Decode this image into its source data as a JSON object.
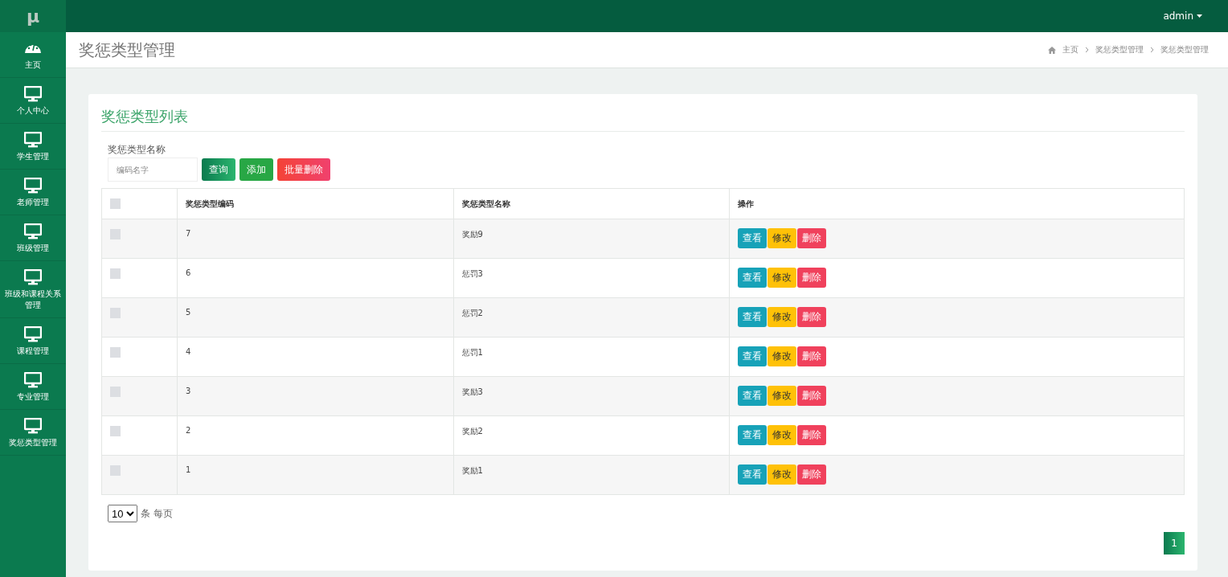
{
  "sidebar": {
    "logo": "μ",
    "items": [
      {
        "label": "主页",
        "kind": "gauge"
      },
      {
        "label": "个人中心",
        "kind": "monitor"
      },
      {
        "label": "学生管理",
        "kind": "monitor"
      },
      {
        "label": "老师管理",
        "kind": "monitor"
      },
      {
        "label": "班级管理",
        "kind": "monitor"
      },
      {
        "label": "班级和课程关系管理",
        "kind": "monitor"
      },
      {
        "label": "课程管理",
        "kind": "monitor"
      },
      {
        "label": "专业管理",
        "kind": "monitor"
      },
      {
        "label": "奖惩类型管理",
        "kind": "monitor"
      }
    ]
  },
  "topbar": {
    "user": "admin"
  },
  "header": {
    "title": "奖惩类型管理",
    "breadcrumb": [
      "主页",
      "奖惩类型管理",
      "奖惩类型管理"
    ]
  },
  "card": {
    "title": "奖惩类型列表",
    "search": {
      "label": "奖惩类型名称",
      "placeholder": "编码名字"
    },
    "buttons": [
      {
        "label": "查询",
        "kind": "query"
      },
      {
        "label": "添加",
        "kind": "add"
      },
      {
        "label": "批量删除",
        "kind": "delete"
      }
    ],
    "table": {
      "header_checked": false,
      "columns": [
        "奖惩类型编码",
        "奖惩类型名称",
        "操作"
      ],
      "rows": [
        {
          "checked": false,
          "code": "7",
          "name": "奖励9",
          "actions": [
            "查看",
            "修改",
            "删除"
          ]
        },
        {
          "checked": false,
          "code": "6",
          "name": "惩罚3",
          "actions": [
            "查看",
            "修改",
            "删除"
          ]
        },
        {
          "checked": false,
          "code": "5",
          "name": "惩罚2",
          "actions": [
            "查看",
            "修改",
            "删除"
          ]
        },
        {
          "checked": false,
          "code": "4",
          "name": "惩罚1",
          "actions": [
            "查看",
            "修改",
            "删除"
          ]
        },
        {
          "checked": false,
          "code": "3",
          "name": "奖励3",
          "actions": [
            "查看",
            "修改",
            "删除"
          ]
        },
        {
          "checked": false,
          "code": "2",
          "name": "奖励2",
          "actions": [
            "查看",
            "修改",
            "删除"
          ]
        },
        {
          "checked": false,
          "code": "1",
          "name": "奖励1",
          "actions": [
            "查看",
            "修改",
            "删除"
          ]
        }
      ]
    },
    "page_size": {
      "value": "10",
      "suffix": "条 每页"
    },
    "pages": [
      {
        "label": "1",
        "selected": true
      }
    ]
  }
}
